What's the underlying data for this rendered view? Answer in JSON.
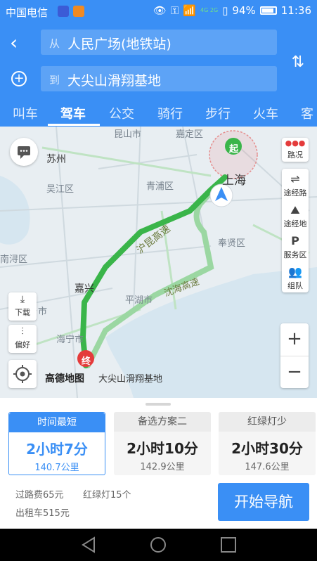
{
  "status_bar": {
    "carrier": "中国电信",
    "network": "4G 2G",
    "battery": "94%",
    "time": "11:36"
  },
  "header": {
    "from_prefix": "从",
    "from_value": "人民广场(地铁站)",
    "to_prefix": "到",
    "to_value": "大尖山滑翔基地"
  },
  "tabs": [
    "叫车",
    "驾车",
    "公交",
    "骑行",
    "步行",
    "火车",
    "客"
  ],
  "active_tab": "驾车",
  "map": {
    "labels": [
      "苏州",
      "昆山市",
      "嘉定区",
      "吴江区",
      "青浦区",
      "上海",
      "奉贤区",
      "南浔区",
      "嘉兴",
      "平湖市",
      "桐乡市",
      "海宁市",
      "大尖山滑翔基地"
    ],
    "road_labels": [
      "沪昆高速",
      "沈海高速"
    ],
    "start_marker": "起",
    "end_marker": "终",
    "side_buttons": [
      "路况",
      "途经路",
      "途经地",
      "服务区",
      "组队"
    ],
    "left_buttons": [
      "下载",
      "偏好"
    ],
    "zoom_in": "+",
    "zoom_out": "−",
    "logo": "高德地图",
    "colors": {
      "route": "#3ab54a",
      "route_alt": "#9bd7a2",
      "water": "#d6e6f0",
      "land": "#e8eef2"
    }
  },
  "routes": [
    {
      "header": "时间最短",
      "time": "2小时7分",
      "distance": "140.7公里",
      "selected": true
    },
    {
      "header": "备选方案二",
      "time": "2小时10分",
      "distance": "142.9公里",
      "selected": false
    },
    {
      "header": "红绿灯少",
      "time": "2小时30分",
      "distance": "147.6公里",
      "selected": false
    }
  ],
  "trip_info": {
    "toll": "过路费65元",
    "lights": "红绿灯15个",
    "taxi": "出租车515元"
  },
  "navigate_button": "开始导航"
}
